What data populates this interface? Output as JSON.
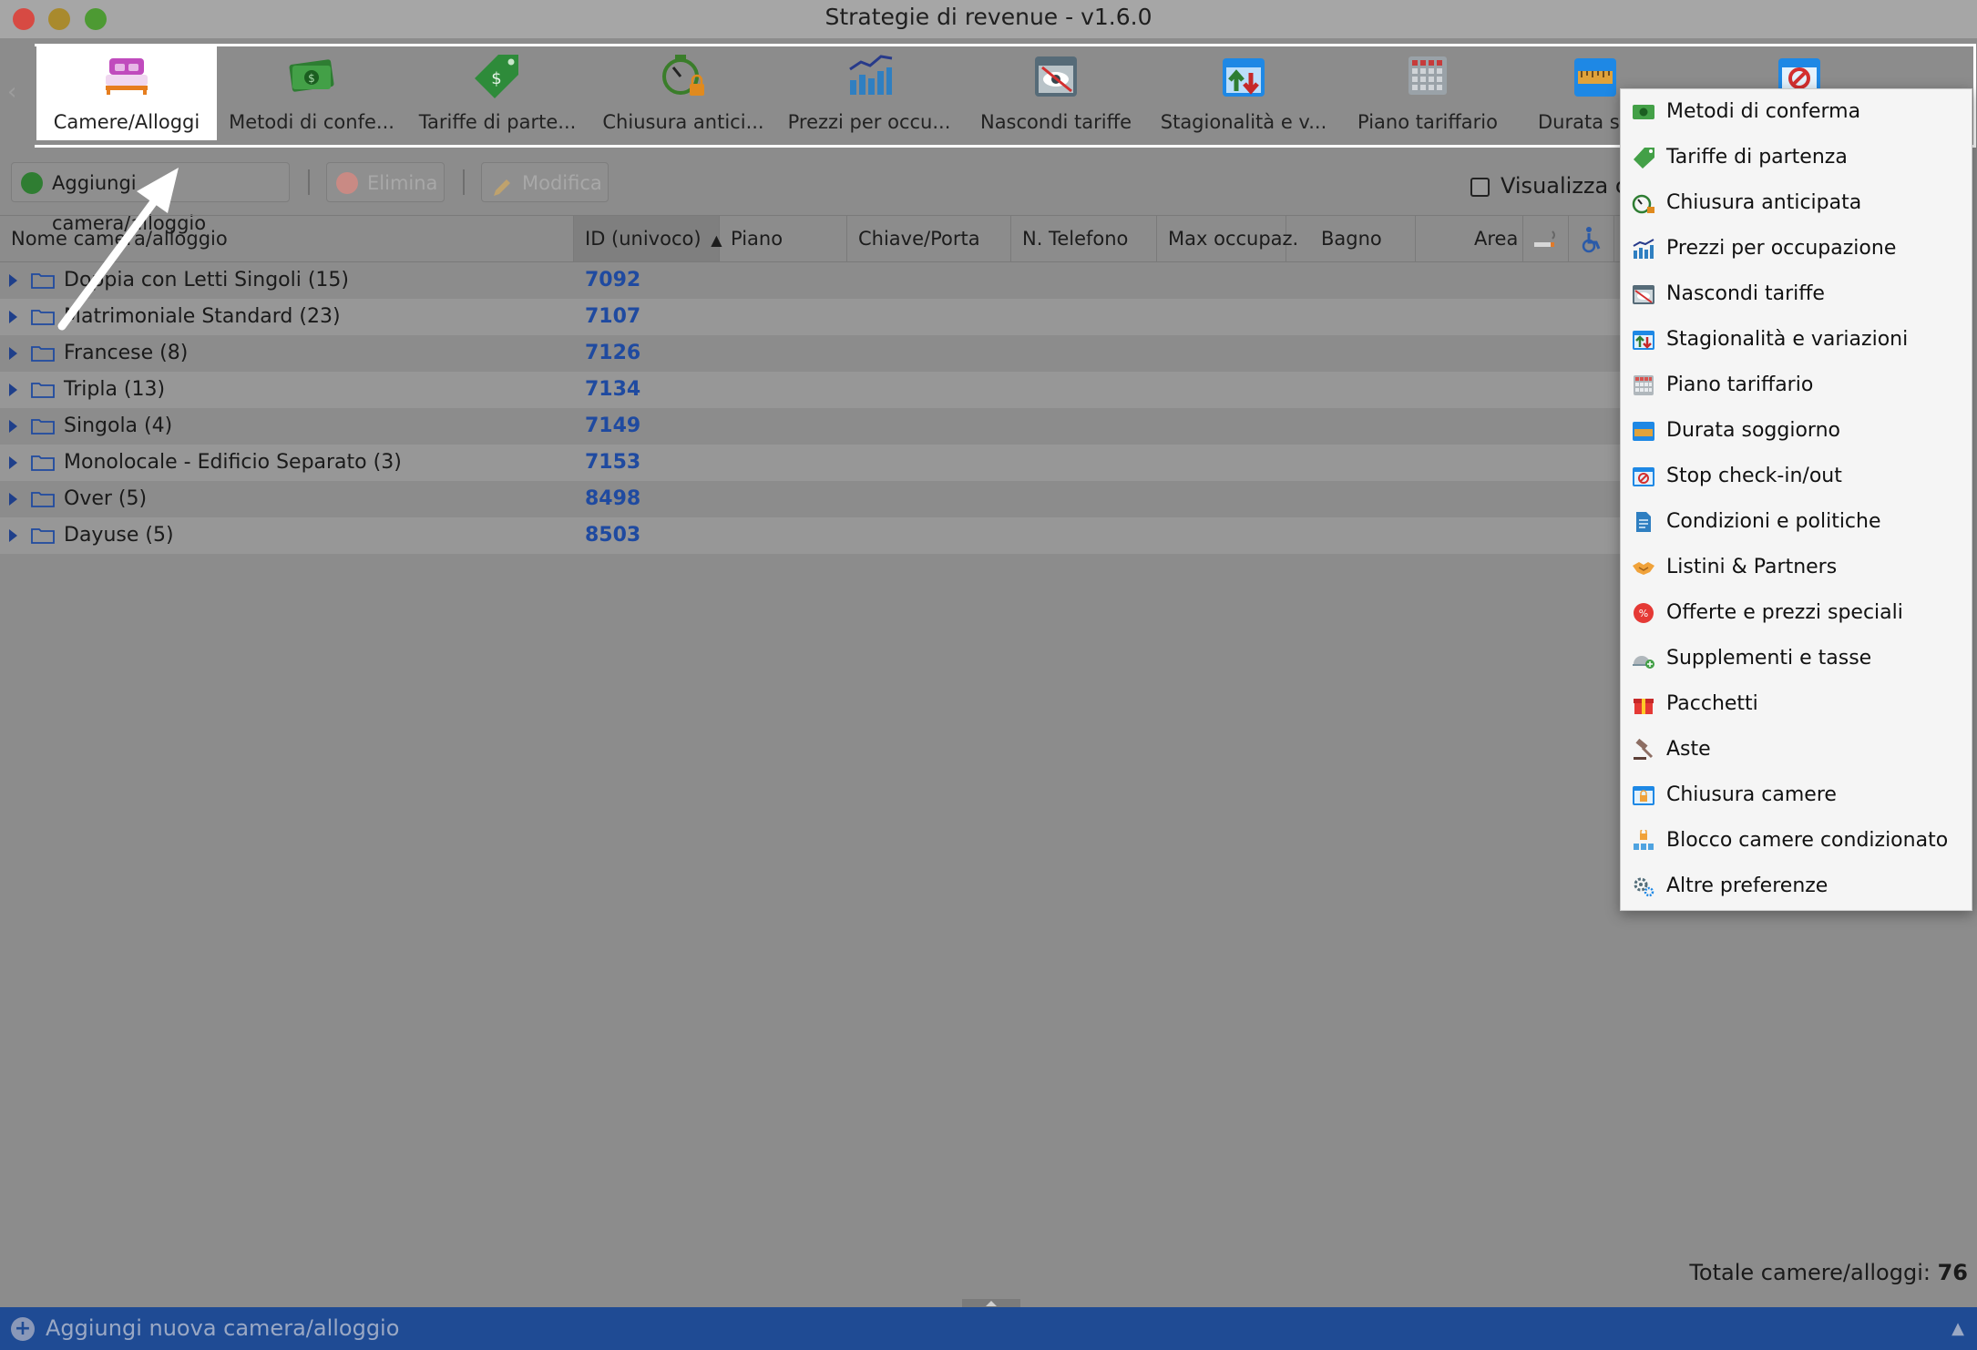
{
  "window": {
    "title": "Strategie di revenue - v1.6.0"
  },
  "toolbar": {
    "items": [
      {
        "label": "Camere/Alloggi",
        "icon": "bed-icon"
      },
      {
        "label": "Metodi di confe...",
        "icon": "money-icon"
      },
      {
        "label": "Tariffe di parte...",
        "icon": "price-tag-icon"
      },
      {
        "label": "Chiusura antici...",
        "icon": "timer-lock-icon"
      },
      {
        "label": "Prezzi per occu...",
        "icon": "bar-chart-icon"
      },
      {
        "label": "Nascondi tariffe",
        "icon": "hidden-eye-icon"
      },
      {
        "label": "Stagionalità e v...",
        "icon": "calendar-arrows-icon"
      },
      {
        "label": "Piano tariffario",
        "icon": "grid-calendar-icon"
      },
      {
        "label": "Durata so",
        "icon": "calendar-ruler-icon"
      },
      {
        "label": "",
        "icon": "calendar-stop-icon"
      }
    ]
  },
  "actions": {
    "add_label": "Aggiungi camera/alloggio",
    "delete_label": "Elimina",
    "edit_label": "Modifica",
    "show_label": "Visualizza ca"
  },
  "table": {
    "columns": [
      "Nome camera/alloggio",
      "ID (univoco)",
      "Piano",
      "Chiave/Porta",
      "N. Telefono",
      "Max occupaz.",
      "Bagno",
      "Area"
    ],
    "rows": [
      {
        "name": "Doppia con Letti Singoli (15)",
        "id": "7092"
      },
      {
        "name": "Matrimoniale Standard (23)",
        "id": "7107"
      },
      {
        "name": "Francese (8)",
        "id": "7126"
      },
      {
        "name": "Tripla (13)",
        "id": "7134"
      },
      {
        "name": "Singola (4)",
        "id": "7149"
      },
      {
        "name": "Monolocale - Edificio Separato (3)",
        "id": "7153"
      },
      {
        "name": "Over (5)",
        "id": "8498"
      },
      {
        "name": "Dayuse (5)",
        "id": "8503"
      }
    ]
  },
  "footer": {
    "total_label": "Totale camere/alloggi:",
    "total_value": "76"
  },
  "bottombar": {
    "label": "Aggiungi nuova camera/alloggio"
  },
  "menu": {
    "items": [
      {
        "label": "Metodi di conferma",
        "icon": "money-icon"
      },
      {
        "label": "Tariffe di partenza",
        "icon": "price-tag-icon"
      },
      {
        "label": "Chiusura anticipata",
        "icon": "timer-lock-icon"
      },
      {
        "label": "Prezzi per occupazione",
        "icon": "bar-chart-icon"
      },
      {
        "label": "Nascondi tariffe",
        "icon": "hidden-eye-icon"
      },
      {
        "label": "Stagionalità e variazioni",
        "icon": "calendar-arrows-icon"
      },
      {
        "label": "Piano tariffario",
        "icon": "grid-calendar-icon"
      },
      {
        "label": "Durata soggiorno",
        "icon": "calendar-ruler-icon"
      },
      {
        "label": "Stop check-in/out",
        "icon": "calendar-stop-icon"
      },
      {
        "label": "Condizioni e politiche",
        "icon": "document-icon"
      },
      {
        "label": "Listini & Partners",
        "icon": "handshake-icon"
      },
      {
        "label": "Offerte e prezzi speciali",
        "icon": "discount-badge-icon"
      },
      {
        "label": "Supplementi e tasse",
        "icon": "cloche-plus-icon"
      },
      {
        "label": "Pacchetti",
        "icon": "gift-icon"
      },
      {
        "label": "Aste",
        "icon": "gavel-icon"
      },
      {
        "label": "Chiusura camere",
        "icon": "calendar-lock-icon"
      },
      {
        "label": "Blocco camere condizionato",
        "icon": "conditional-lock-icon"
      },
      {
        "label": "Altre preferenze",
        "icon": "gears-icon"
      }
    ]
  }
}
